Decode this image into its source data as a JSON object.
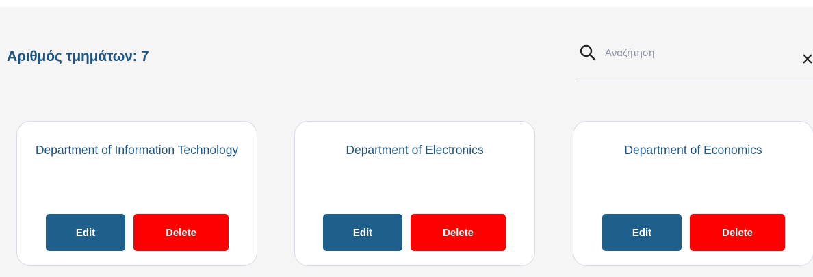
{
  "header": {
    "count_label": "Αριθμός τμημάτων: 7"
  },
  "search": {
    "placeholder": "Αναζήτηση",
    "value": "",
    "icon": "search-icon",
    "clear_icon": "close-icon"
  },
  "cards": [
    {
      "title": "Department of Information Technology",
      "edit_label": "Edit",
      "delete_label": "Delete"
    },
    {
      "title": "Department of Electronics",
      "edit_label": "Edit",
      "delete_label": "Delete"
    },
    {
      "title": "Department of Economics",
      "edit_label": "Edit",
      "delete_label": "Delete"
    }
  ],
  "colors": {
    "primary": "#1f5f8b",
    "heading": "#1f5580",
    "danger": "#ff0000",
    "background": "#f5f5f5",
    "card_border": "#d9dce8"
  }
}
